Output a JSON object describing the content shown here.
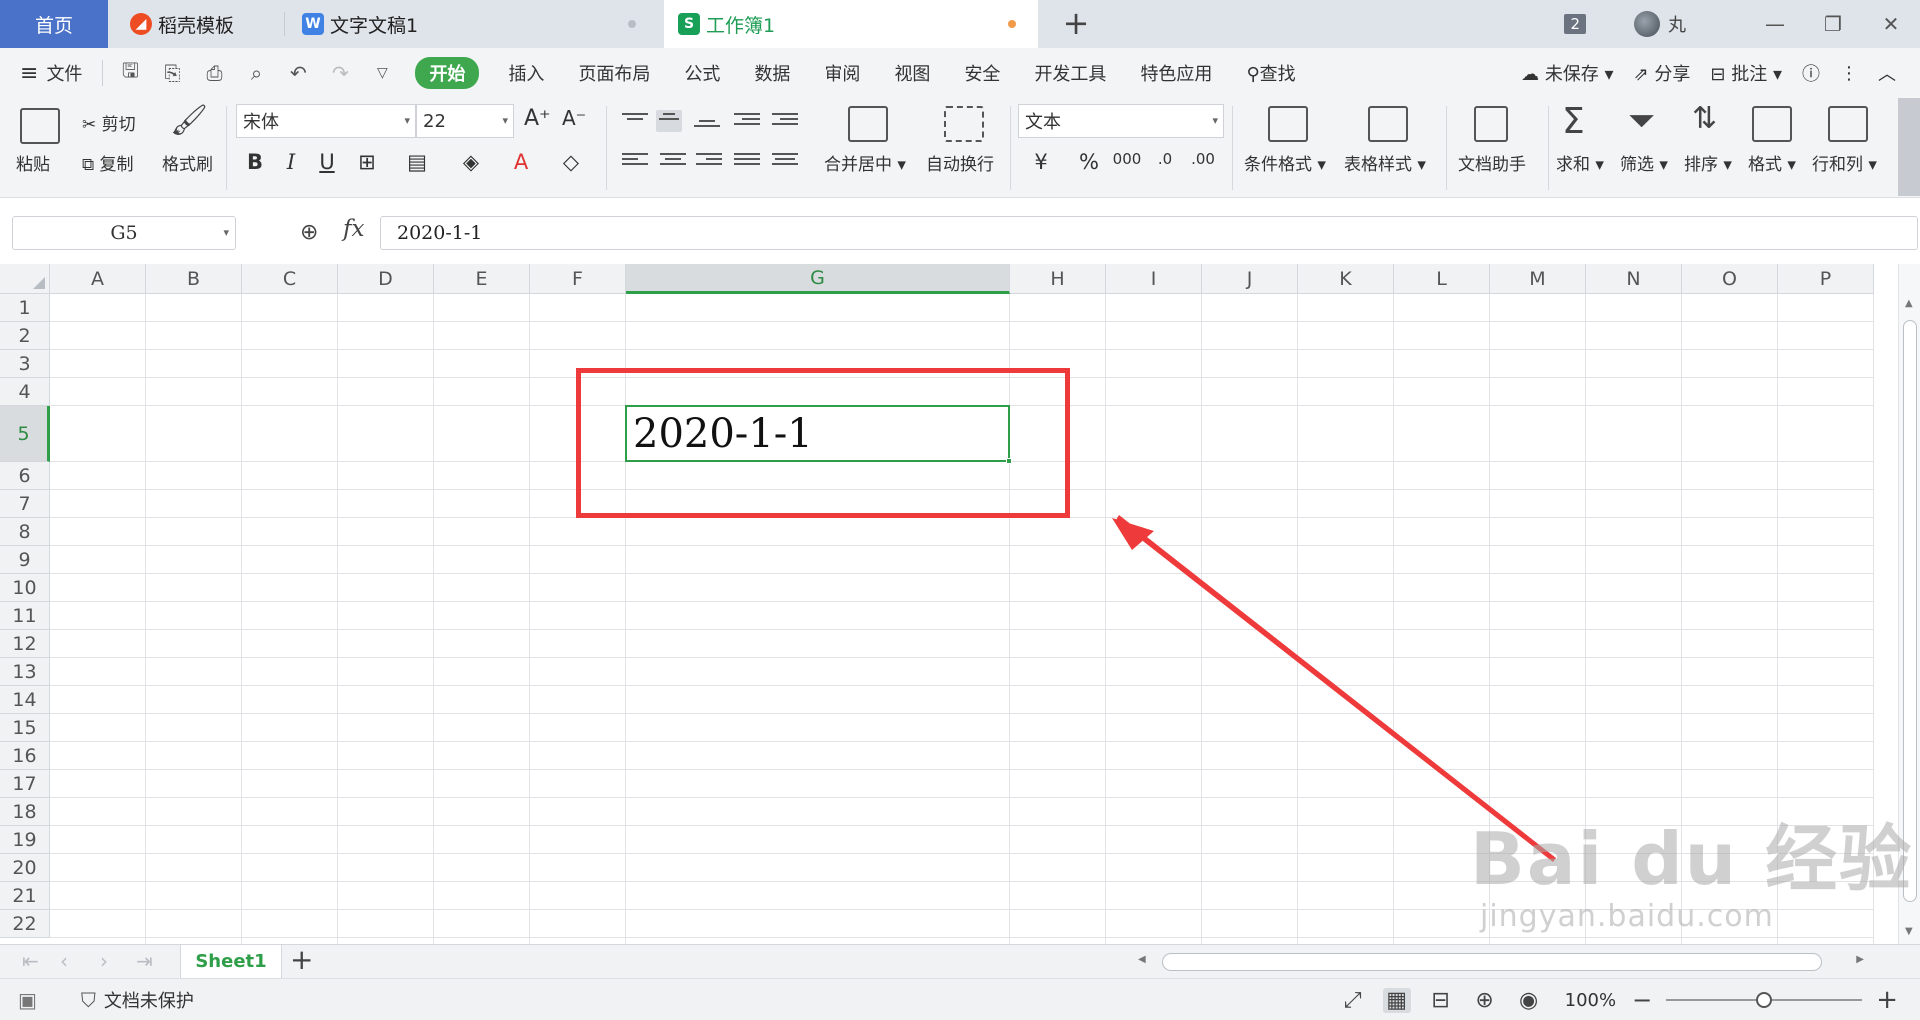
{
  "tabs": [
    {
      "label": "首页",
      "icon": ""
    },
    {
      "label": "稻壳模板",
      "icon": "daoke-icon"
    },
    {
      "label": "文字文稿1",
      "icon": "word-doc-icon"
    },
    {
      "label": "工作簿1",
      "icon": "spreadsheet-icon"
    }
  ],
  "titlebar": {
    "new_tab": "+",
    "window_count": "2",
    "user_name": "丸"
  },
  "menu": {
    "file": "文件",
    "items": [
      "开始",
      "插入",
      "页面布局",
      "公式",
      "数据",
      "审阅",
      "视图",
      "安全",
      "开发工具",
      "特色应用"
    ],
    "active": "开始",
    "search": "查找",
    "right": {
      "unsaved": "未保存",
      "share": "分享",
      "comment": "批注"
    }
  },
  "ribbon": {
    "paste": "粘贴",
    "cut": "剪切",
    "copy": "复制",
    "format_painter": "格式刷",
    "font_name": "宋体",
    "font_size": "22",
    "bold": "B",
    "italic": "I",
    "underline": "U",
    "merge_center": "合并居中",
    "wrap_text": "自动换行",
    "number_format": "文本",
    "conditional_format": "条件格式",
    "table_style": "表格样式",
    "doc_assistant": "文档助手",
    "sum": "求和",
    "filter": "筛选",
    "sort": "排序",
    "format": "格式",
    "row_col": "行和列"
  },
  "formula_bar": {
    "cell_ref": "G5",
    "fx": "fx",
    "content": "2020-1-1"
  },
  "grid": {
    "columns": [
      "A",
      "B",
      "C",
      "D",
      "E",
      "F",
      "G",
      "H",
      "I",
      "J",
      "K",
      "L",
      "M",
      "N",
      "O",
      "P"
    ],
    "rows": [
      "1",
      "2",
      "3",
      "4",
      "5",
      "6",
      "7",
      "8",
      "9",
      "10",
      "11",
      "12",
      "13",
      "14",
      "15",
      "16",
      "17",
      "18",
      "19",
      "20",
      "21",
      "22"
    ],
    "selected_column": "G",
    "selected_row": "5",
    "active_cell_value": "2020-1-1"
  },
  "annotation": {
    "color": "#ee3a3a"
  },
  "watermark": {
    "logo": "Bai du 经验",
    "url": "jingyan.baidu.com"
  },
  "sheets": {
    "tabs": [
      "Sheet1"
    ],
    "add": "+"
  },
  "status": {
    "protection": "文档未保护",
    "zoom": "100%",
    "zoom_minus": "−",
    "zoom_plus": "+"
  },
  "colors": {
    "accent_green": "#2e9e48",
    "home_tab_blue": "#4a72c8"
  }
}
